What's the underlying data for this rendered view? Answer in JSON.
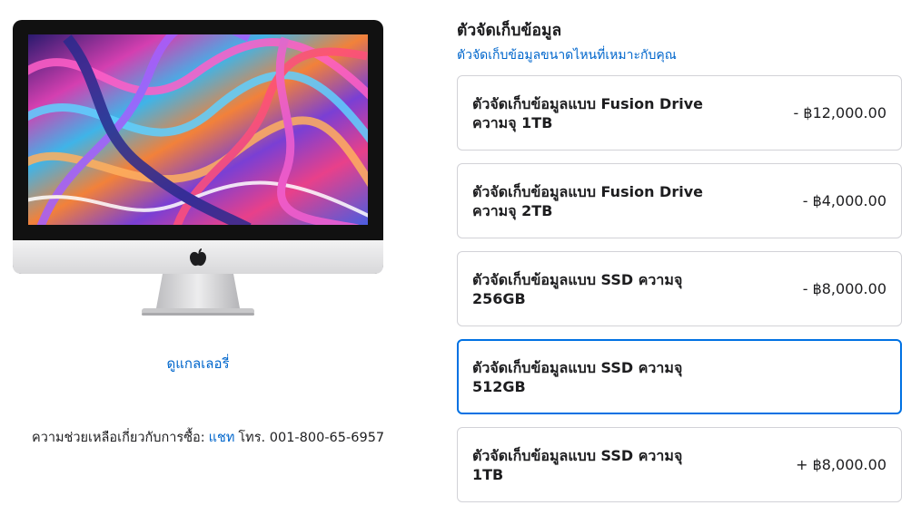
{
  "gallery": {
    "label": "ดูแกลเลอรี่"
  },
  "help": {
    "prefix": "ความช่วยเหลือเกี่ยวกับการซื้อ:",
    "chat_label": "แชท",
    "phone": "โทร. 001-800-65-6957"
  },
  "storage": {
    "title": "ตัวจัดเก็บข้อมูล",
    "help_link": "ตัวจัดเก็บข้อมูลขนาดไหนที่เหมาะกับคุณ",
    "options": [
      {
        "name": "ตัวจัดเก็บข้อมูลแบบ Fusion Drive ความจุ 1TB",
        "price": "- ฿12,000.00",
        "selected": false
      },
      {
        "name": "ตัวจัดเก็บข้อมูลแบบ Fusion Drive ความจุ 2TB",
        "price": "- ฿4,000.00",
        "selected": false
      },
      {
        "name": "ตัวจัดเก็บข้อมูลแบบ SSD ความจุ 256GB",
        "price": "- ฿8,000.00",
        "selected": false
      },
      {
        "name": "ตัวจัดเก็บข้อมูลแบบ SSD ความจุ 512GB",
        "price": "",
        "selected": true
      },
      {
        "name": "ตัวจัดเก็บข้อมูลแบบ SSD ความจุ 1TB",
        "price": "+ ฿8,000.00",
        "selected": false
      }
    ]
  },
  "colors": {
    "link": "#0066cc",
    "selected_border": "#0071e3",
    "border": "#d2d2d7"
  },
  "icons": {
    "product": "imac-image",
    "logo": "apple-logo-icon"
  }
}
